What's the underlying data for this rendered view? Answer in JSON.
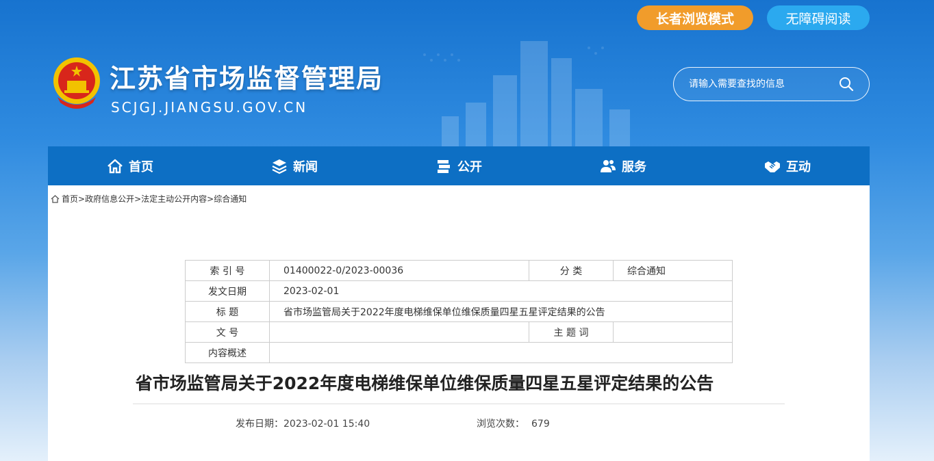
{
  "header": {
    "elder_mode_label": "长者浏览模式",
    "accessible_label": "无障碍阅读",
    "site_title": "江苏省市场监督管理局",
    "site_domain": "SCJGJ.JIANGSU.GOV.CN",
    "search_placeholder": "请输入需要查找的信息"
  },
  "nav": {
    "items": [
      {
        "label": "首页",
        "icon": "home-icon"
      },
      {
        "label": "新闻",
        "icon": "layers-icon"
      },
      {
        "label": "公开",
        "icon": "books-icon"
      },
      {
        "label": "服务",
        "icon": "users-icon"
      },
      {
        "label": "互动",
        "icon": "handshake-icon"
      }
    ]
  },
  "breadcrumb": {
    "home": "首页",
    "sep": ">",
    "items": [
      "政府信息公开",
      "法定主动公开内容",
      "综合通知"
    ]
  },
  "meta": {
    "index_label": "索 引 号",
    "index_value": "01400022-0/2023-00036",
    "category_label": "分 类",
    "category_value": "综合通知",
    "date_label": "发文日期",
    "date_value": "2023-02-01",
    "title_label": "标 题",
    "title_value": "省市场监管局关于2022年度电梯维保单位维保质量四星五星评定结果的公告",
    "docno_label": "文 号",
    "docno_value": "",
    "keyword_label": "主 题 词",
    "keyword_value": "",
    "summary_label": "内容概述",
    "summary_value": ""
  },
  "article": {
    "title": "省市场监管局关于2022年度电梯维保单位维保质量四星五星评定结果的公告",
    "pub_date_label": "发布日期：",
    "pub_date_value": "2023-02-01 15:40",
    "views_label": "浏览次数：",
    "views_value": "679"
  },
  "colors": {
    "nav_bg": "#0d6fc4",
    "elder_btn": "#f19c2b",
    "access_btn": "#2ba9ef"
  }
}
